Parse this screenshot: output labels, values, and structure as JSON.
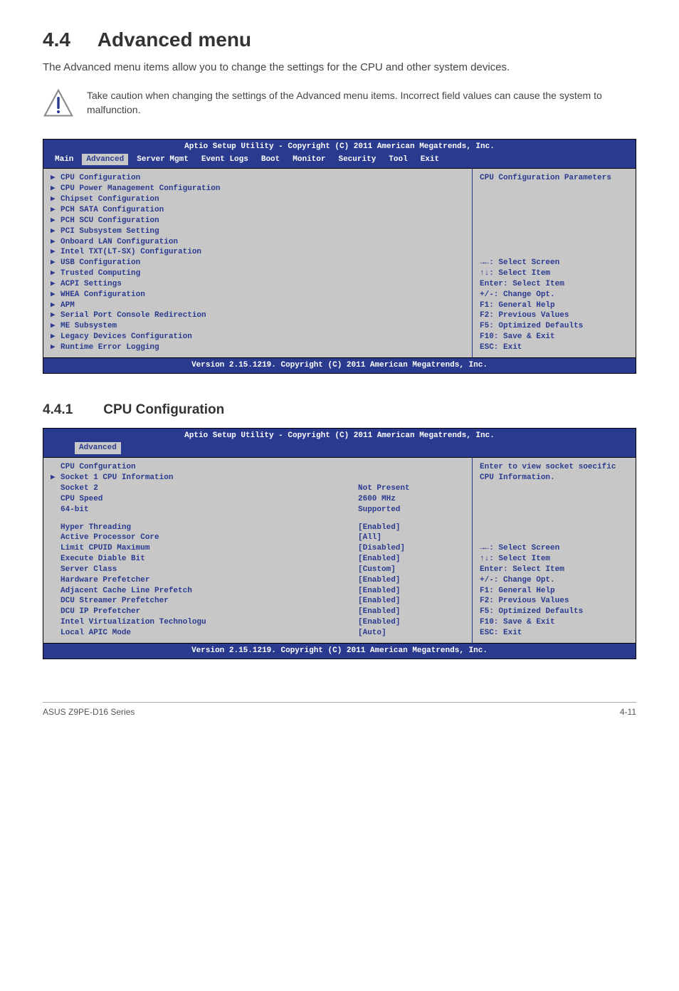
{
  "page": {
    "heading_num": "4.4",
    "heading": "Advanced menu",
    "intro": "The Advanced menu items allow you to change the settings for the CPU and other system devices.",
    "note": "Take caution when changing the settings of the Advanced menu items. Incorrect field values can cause the system to malfunction."
  },
  "bios1": {
    "header": "Aptio Setup Utility - Copyright (C) 2011 American Megatrends, Inc.",
    "menu": [
      "Main",
      "Advanced",
      "Server Mgmt",
      "Event Logs",
      "Boot",
      "Monitor",
      "Security",
      "Tool",
      "Exit"
    ],
    "active_menu": "Advanced",
    "left_items": [
      "CPU Configuration",
      "CPU Power Management Configuration",
      "Chipset Configuration",
      "PCH SATA Configuration",
      "PCH SCU Configuration",
      "PCI Subsystem Setting",
      "Onboard LAN Configuration",
      "Intel TXT(LT-SX) Configuration",
      "USB Configuration",
      "Trusted Computing",
      "ACPI Settings",
      "WHEA Configuration",
      "APM",
      "Serial Port Console Redirection",
      "ME Subsystem",
      "Legacy Devices Configuration",
      "Runtime Error Logging"
    ],
    "right_top": "CPU Configuration Parameters",
    "right_help": [
      "→←: Select Screen",
      "↑↓:  Select Item",
      "Enter: Select Item",
      "+/-: Change Opt.",
      "F1: General Help",
      "F2: Previous Values",
      "F5: Optimized Defaults",
      "F10: Save & Exit",
      "ESC: Exit"
    ],
    "footer": "Version 2.15.1219. Copyright (C) 2011 American Megatrends, Inc."
  },
  "section2": {
    "num": "4.4.1",
    "title": "CPU Configuration"
  },
  "bios2": {
    "header": "Aptio Setup Utility - Copyright (C) 2011 American Megatrends, Inc.",
    "active_menu": "Advanced",
    "title": "CPU Confguration",
    "sock_label": "Socket 1 CPU Information",
    "rows_top": [
      {
        "lbl": "Socket 2",
        "val": "Not Present"
      },
      {
        "lbl": "",
        "val": ""
      },
      {
        "lbl": "CPU Speed",
        "val": "2600 MHz"
      },
      {
        "lbl": "64-bit",
        "val": "Supported"
      }
    ],
    "rows_opts": [
      {
        "lbl": "Hyper Threading",
        "val": "[Enabled]"
      },
      {
        "lbl": "Active Processor Core",
        "val": "[All]"
      },
      {
        "lbl": "Limit CPUID Maximum",
        "val": "[Disabled]"
      },
      {
        "lbl": "Execute Diable Bit",
        "val": "[Enabled]"
      },
      {
        "lbl": "Server Class",
        "val": "[Custom]"
      },
      {
        "lbl": "Hardware Prefetcher",
        "val": "[Enabled]"
      },
      {
        "lbl": "Adjacent Cache Line Prefetch",
        "val": "[Enabled]"
      },
      {
        "lbl": "DCU Streamer Prefetcher",
        "val": "[Enabled]"
      },
      {
        "lbl": "DCU IP Prefetcher",
        "val": "[Enabled]"
      },
      {
        "lbl": "Intel Virtualization Technologu",
        "val": "[Enabled]"
      },
      {
        "lbl": "Local APIC Mode",
        "val": "[Auto]"
      }
    ],
    "right_top": "Enter to view socket soecific CPU Information.",
    "right_help": [
      "→←: Select Screen",
      "↑↓:  Select Item",
      "Enter: Select Item",
      "+/-: Change Opt.",
      "F1: General Help",
      "F2: Previous Values",
      "F5: Optimized Defaults",
      "F10: Save & Exit",
      "ESC: Exit"
    ],
    "footer": "Version 2.15.1219. Copyright (C) 2011 American Megatrends, Inc."
  },
  "footer": {
    "left": "ASUS Z9PE-D16 Series",
    "right": "4-11"
  }
}
